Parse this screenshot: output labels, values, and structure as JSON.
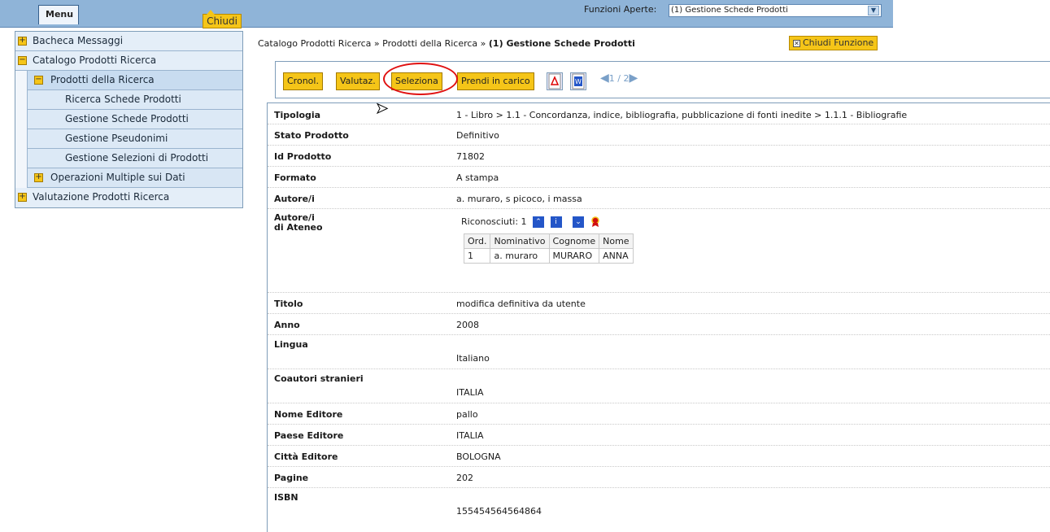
{
  "topbar": {
    "menu_label": "Menu",
    "chiudi_label": "Chiudi",
    "funzioni_label": "Funzioni Aperte:",
    "funzioni_selected": "(1) Gestione Schede Prodotti"
  },
  "sidebar": {
    "items": [
      {
        "label": "Bacheca Messaggi",
        "toggle": "+"
      },
      {
        "label": "Catalogo Prodotti Ricerca",
        "toggle": "−"
      },
      {
        "label": "Prodotti della Ricerca",
        "toggle": "−"
      },
      {
        "label": "Ricerca Schede Prodotti"
      },
      {
        "label": "Gestione Schede Prodotti"
      },
      {
        "label": "Gestione Pseudonimi"
      },
      {
        "label": "Gestione Selezioni di Prodotti"
      },
      {
        "label": "Operazioni Multiple sui Dati",
        "toggle": "+"
      },
      {
        "label": "Valutazione Prodotti Ricerca",
        "toggle": "+"
      }
    ]
  },
  "breadcrumb": {
    "part1": "Catalogo Prodotti Ricerca",
    "sep": "»",
    "part2": "Prodotti della Ricerca",
    "current": "(1) Gestione Schede Prodotti"
  },
  "chiudi_funzione_label": "Chiudi Funzione",
  "toolbar": {
    "cronol": "Cronol.",
    "valutaz": "Valutaz.",
    "seleziona": "Seleziona",
    "prendi": "Prendi in carico",
    "pager_text": "1 / 2"
  },
  "fields": {
    "tipologia": {
      "k": "Tipologia",
      "v": "1 - Libro > 1.1 - Concordanza, indice, bibliografia, pubblicazione di fonti inedite > 1.1.1 - Bibliografie"
    },
    "stato": {
      "k": "Stato Prodotto",
      "v": "Definitivo"
    },
    "id": {
      "k": "Id Prodotto",
      "v": "71802"
    },
    "formato": {
      "k": "Formato",
      "v": "A stampa"
    },
    "autori": {
      "k": "Autore/i",
      "v": "a. muraro, s picoco, i massa"
    },
    "autori_ateneo": {
      "k1": "Autore/i",
      "k2": "di Ateneo",
      "riconosciuti": "Riconosciuti: 1"
    },
    "titolo": {
      "k": "Titolo",
      "v": "modifica definitiva da utente"
    },
    "anno": {
      "k": "Anno",
      "v": "2008"
    },
    "lingua": {
      "k": "Lingua",
      "v": "Italiano"
    },
    "coautori": {
      "k": "Coautori stranieri",
      "v": "ITALIA"
    },
    "nome_editore": {
      "k": "Nome Editore",
      "v": "pallo"
    },
    "paese_editore": {
      "k": "Paese Editore",
      "v": "ITALIA"
    },
    "citta_editore": {
      "k": "Città Editore",
      "v": "BOLOGNA"
    },
    "pagine": {
      "k": "Pagine",
      "v": "202"
    },
    "isbn": {
      "k": "ISBN",
      "v": "155454564564864"
    }
  },
  "autori_table": {
    "headers": [
      "Ord.",
      "Nominativo",
      "Cognome",
      "Nome"
    ],
    "rows": [
      [
        "1",
        "a. muraro",
        "MURARO",
        "ANNA"
      ]
    ]
  },
  "colors": {
    "accent": "#f5c518",
    "topbar": "#8fb4d8",
    "highlight": "#e01010"
  }
}
